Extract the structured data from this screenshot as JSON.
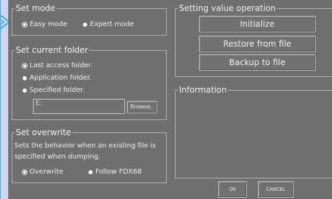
{
  "set_mode": {
    "title": "Set mode",
    "options": [
      "Easy mode",
      "Expert mode"
    ],
    "selected": "Easy mode"
  },
  "set_folder": {
    "title": "Set current folder",
    "options": [
      "Last access folder.",
      "Application  folder.",
      "Specified folder."
    ],
    "selected": "Last access folder.",
    "path_value": "E:",
    "browse_label": "Browse.."
  },
  "set_overwrite": {
    "title": "Set overwrite",
    "description_line1": "Sets the behavior when an existing file is",
    "description_line2": "specified when dumping.",
    "options": [
      "Overwrite",
      "Follow FDX68"
    ],
    "selected": "Overwrite"
  },
  "setting_value": {
    "title": "Setting value operation",
    "buttons": [
      "Initialize",
      "Restore from file",
      "Backup to file"
    ]
  },
  "information": {
    "title": "Information",
    "text": ""
  },
  "dialog_buttons": {
    "ok": "OK",
    "cancel": "CANCEL"
  },
  "colors": {
    "panel": "#6f6f6f",
    "border": "#b8b8b8",
    "text": "#f2f2f2",
    "backdrop": "#cdd6f2",
    "accent_line": "#3fa9e0"
  }
}
